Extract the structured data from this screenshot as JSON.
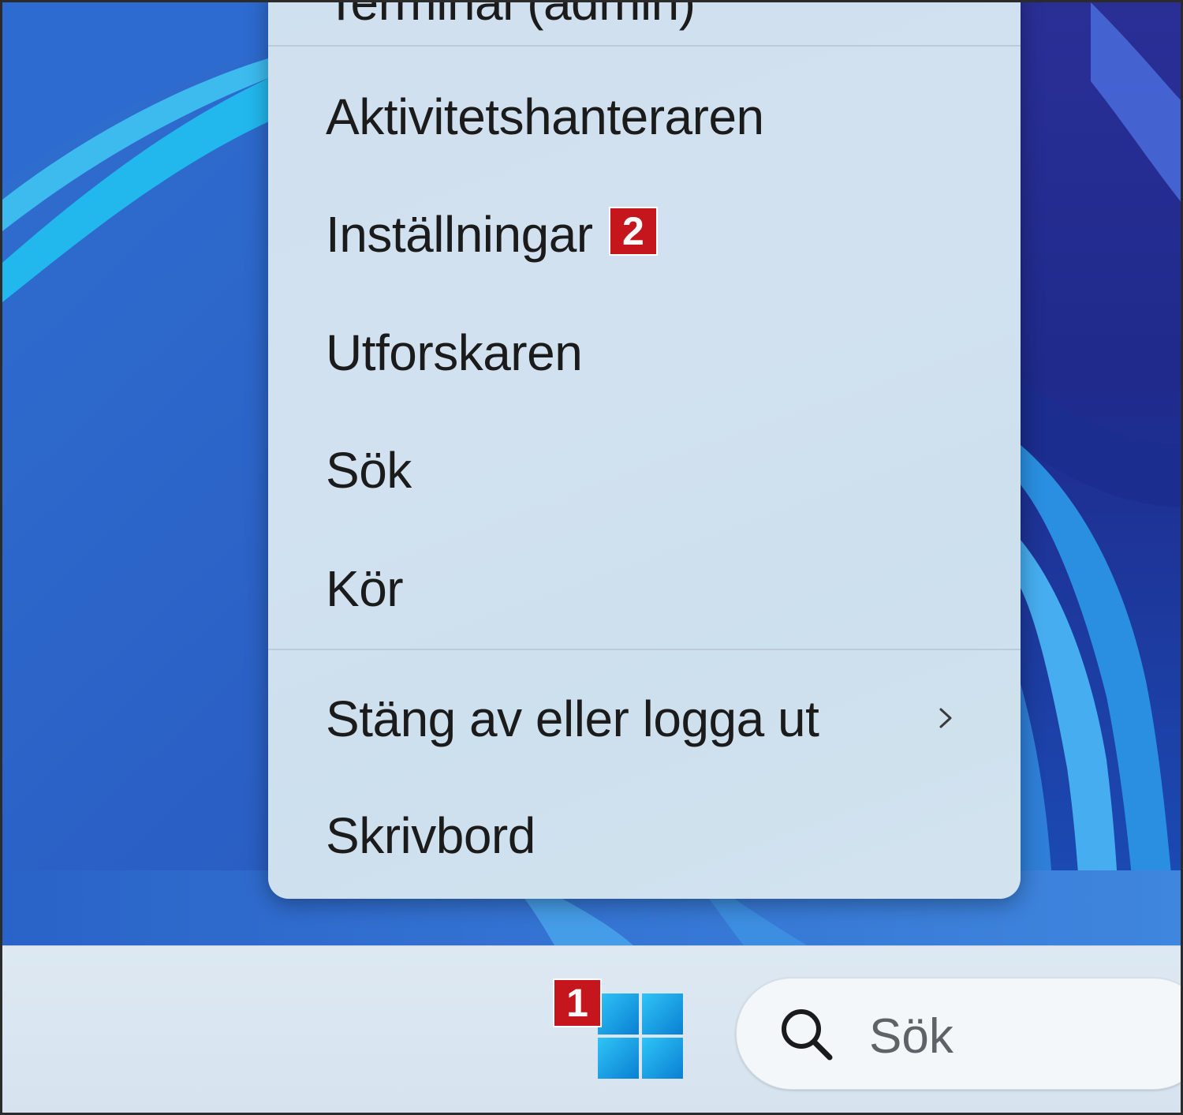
{
  "context_menu": {
    "items": [
      {
        "label": "Terminal (admin)",
        "partially_visible": true
      },
      {
        "label": "Aktivitetshanteraren"
      },
      {
        "label": "Inställningar",
        "step_badge": "2"
      },
      {
        "label": "Utforskaren"
      },
      {
        "label": "Sök"
      },
      {
        "label": "Kör"
      },
      {
        "label": "Stäng av eller logga ut",
        "submenu": true,
        "icon": "chevron-right-icon"
      },
      {
        "label": "Skrivbord"
      }
    ]
  },
  "taskbar": {
    "start_icon": "windows-logo-icon",
    "start_step_badge": "1",
    "search": {
      "icon": "search-icon",
      "label": "Sök"
    }
  },
  "colors": {
    "step_badge": "#c4161c",
    "menu_background": "#cfe0ef",
    "taskbar_background": "#dde8f2",
    "wallpaper_dark": "#0e1a6e",
    "wallpaper_accent": "#1aa3e0"
  }
}
